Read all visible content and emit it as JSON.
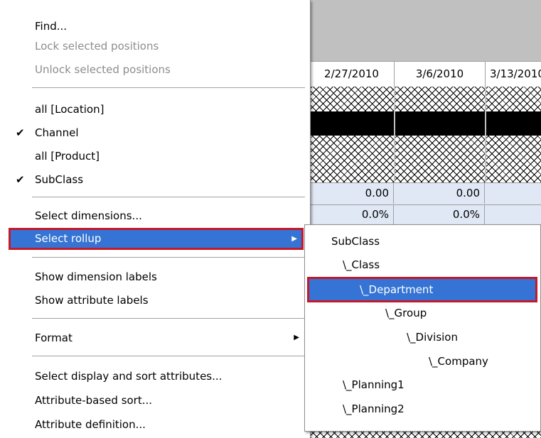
{
  "grid": {
    "dates": [
      "2/27/2010",
      "3/6/2010",
      "3/13/2010"
    ],
    "row_values": [
      "0.00",
      "0.00"
    ],
    "row_percents": [
      "0.0%",
      "0.0%"
    ]
  },
  "menu": {
    "find": "Find...",
    "lock": "Lock selected positions",
    "unlock": "Unlock selected positions",
    "all_location": "all [Location]",
    "channel": "Channel",
    "all_product": "all [Product]",
    "subclass": "SubClass",
    "check_glyph": "✔",
    "select_dimensions": "Select dimensions...",
    "select_rollup": "Select rollup",
    "show_dimension_labels": "Show dimension labels",
    "show_attribute_labels": "Show attribute labels",
    "format": "Format",
    "select_display_sort": "Select display and sort attributes...",
    "attribute_sort": "Attribute-based sort...",
    "attribute_definition": "Attribute definition...",
    "arrow_glyph": "▶"
  },
  "submenu": {
    "items": [
      "SubClass",
      "\\_Class",
      "\\_Department",
      "\\_Group",
      "\\_Division",
      "\\_Company",
      "\\_Planning1",
      "\\_Planning2"
    ],
    "selected": "\\_Department"
  },
  "colors": {
    "highlight": "#3574d4",
    "highlight_border": "#c4192b",
    "disabled_text": "#8d8d8d",
    "header_gray": "#c0c0c0",
    "row_blue": "#dfe8f4"
  }
}
